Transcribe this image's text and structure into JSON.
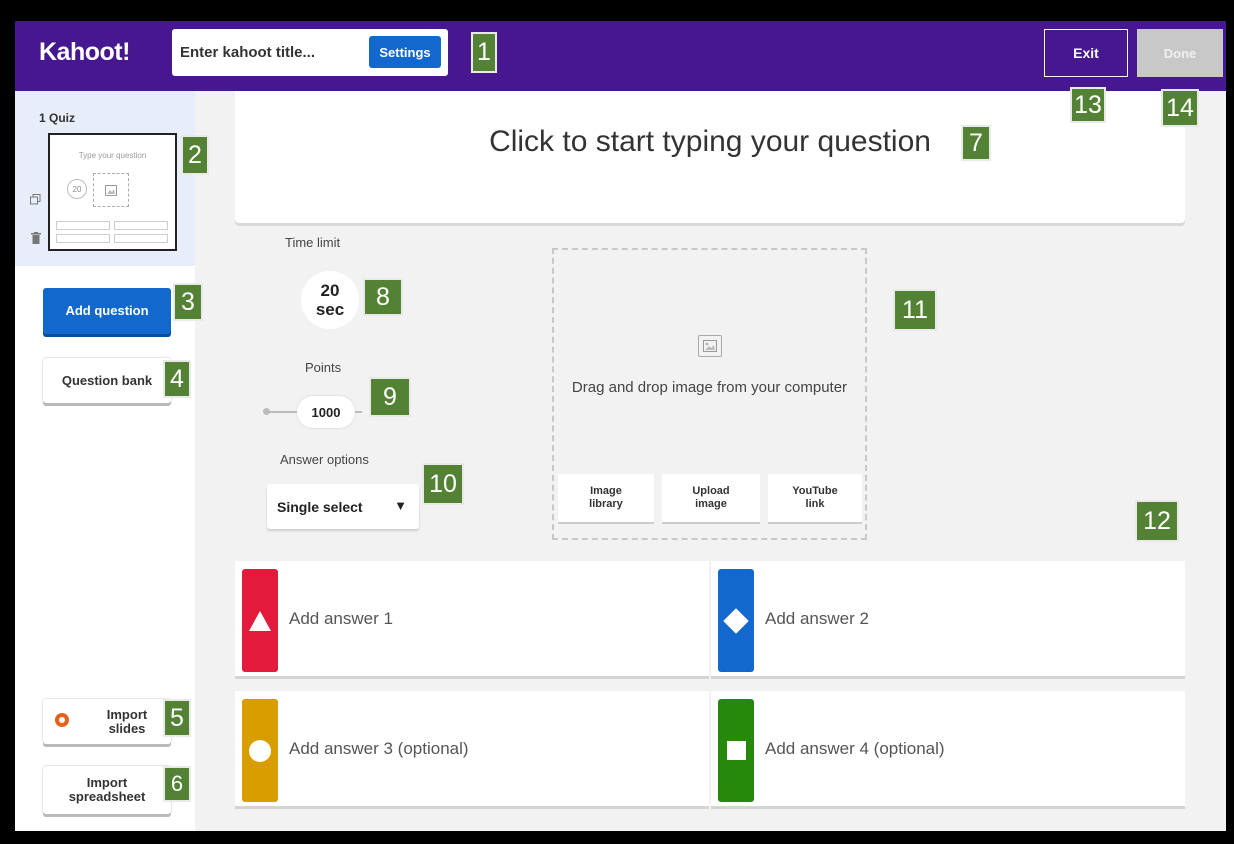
{
  "app": {
    "logo": "Kahoot!"
  },
  "header": {
    "title_placeholder": "Enter kahoot title...",
    "settings_label": "Settings",
    "exit_label": "Exit",
    "done_label": "Done"
  },
  "sidebar": {
    "quiz_label": "1 Quiz",
    "thumb_question": "Type your question",
    "thumb_time": "20",
    "add_question_label": "Add question",
    "question_bank_label": "Question bank",
    "import_slides_label": "Import slides",
    "import_spreadsheet_label": "Import spreadsheet"
  },
  "question": {
    "placeholder": "Click to start typing your question"
  },
  "settings": {
    "time_limit_label": "Time limit",
    "time_value": "20",
    "time_unit": "sec",
    "points_label": "Points",
    "points_value": "1000",
    "answer_options_label": "Answer options",
    "answer_options_value": "Single select"
  },
  "media": {
    "drag_text": "Drag and drop image from your computer",
    "image_library": "Image library",
    "upload_image": "Upload image",
    "youtube_link": "YouTube link"
  },
  "answers": [
    {
      "label": "Add answer 1",
      "color": "#e21b3c",
      "shape": "triangle"
    },
    {
      "label": "Add answer 2",
      "color": "#1368ce",
      "shape": "diamond"
    },
    {
      "label": "Add answer 3 (optional)",
      "color": "#d89e00",
      "shape": "circle"
    },
    {
      "label": "Add answer 4 (optional)",
      "color": "#26890c",
      "shape": "square"
    }
  ],
  "annotations": [
    "1",
    "2",
    "3",
    "4",
    "5",
    "6",
    "7",
    "8",
    "9",
    "10",
    "11",
    "12",
    "13",
    "14"
  ],
  "colors": {
    "brand": "#46178f",
    "accent": "#1368ce",
    "badge": "#548235"
  }
}
